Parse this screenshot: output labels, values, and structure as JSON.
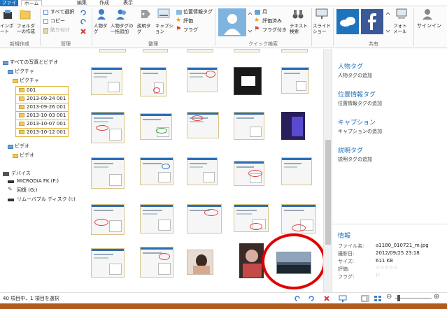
{
  "tabs": [
    "ファイル",
    "ホーム",
    "編集",
    "作成",
    "表示"
  ],
  "ribbon": {
    "import_label": "インポート",
    "new_folder_label": "フォルダーの作成",
    "group_new": "新規作成",
    "select_all": "すべて選択",
    "copy": "コピー",
    "paste": "貼り付け",
    "group_manage": "管理",
    "people_tag": "人物タグ",
    "people_batch": "人物タグの一括追加",
    "desc_tag": "説明タグ",
    "caption": "キャプション",
    "geotag": "位置情報タグ",
    "rating": "評価",
    "flag": "フラグ",
    "group_organize": "整理",
    "month": "月",
    "rated": "評価済み",
    "flagged": "フラグ付き",
    "text_search": "テキスト検索",
    "group_quick_search": "クイック検索",
    "slideshow": "スライドショー",
    "photo_mail": "フォトメール",
    "group_share": "共有",
    "signin": "サインイン"
  },
  "nav": {
    "all_photos": "すべての写真とビデオ",
    "pictures_lib": "ピクチャ",
    "pictures": "ピクチャ",
    "folders": [
      "001",
      "2013-09-24 001",
      "2013-09-26 001",
      "2013-10-03 001",
      "2013-10-07 001",
      "2013-10-12 001"
    ],
    "videos_lib": "ビデオ",
    "videos": "ビデオ",
    "devices": "デバイス",
    "device_items": [
      "MICRODIA FK (F:)",
      "回復 (G:)",
      "リムーバブル ディスク (I:)"
    ]
  },
  "details": {
    "people_tag_title": "人物タグ",
    "people_tag_add": "人物タグの追加",
    "geotag_title": "位置情報タグ",
    "geotag_add": "位置情報タグの追加",
    "caption_title": "キャプション",
    "caption_add": "キャプションの追加",
    "desc_title": "説明タグ",
    "desc_add": "説明タグの追加",
    "info_title": "情報",
    "info": [
      {
        "k": "ファイル名:",
        "v": "a1180_010721_m.jpg"
      },
      {
        "k": "撮影日:",
        "v": "2012/09/25 23:18"
      },
      {
        "k": "サイズ:",
        "v": "611 KB"
      },
      {
        "k": "評価:",
        "v": "☆☆☆☆☆"
      },
      {
        "k": "フラグ:",
        "v": "⚐"
      }
    ]
  },
  "status": {
    "text": "40 項目中、1 項目を選択"
  },
  "colors": {
    "accent": "#1e73be",
    "highlight_circle": "#e00000",
    "taskbar": "#b35a1f"
  }
}
